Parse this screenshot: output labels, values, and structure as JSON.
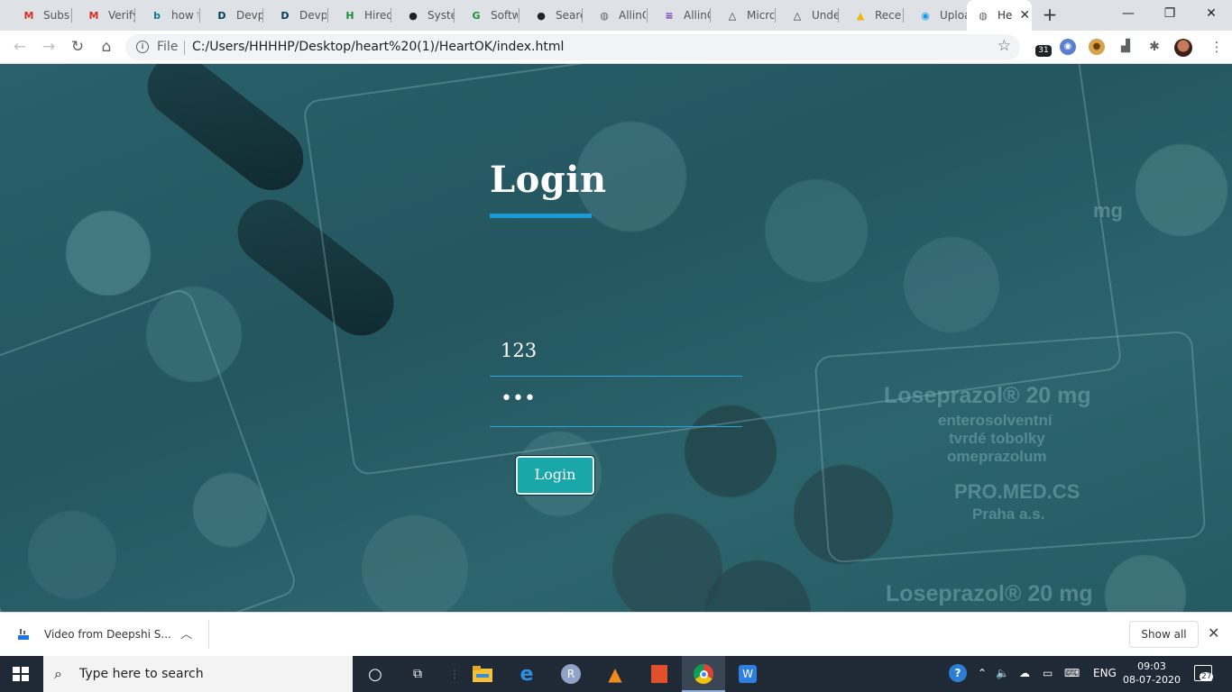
{
  "browser": {
    "tabs": [
      {
        "title": "Subsc",
        "icon": "gmail-icon",
        "glyph": "M",
        "color": "#d93025"
      },
      {
        "title": "Verify",
        "icon": "gmail-icon",
        "glyph": "M",
        "color": "#d93025"
      },
      {
        "title": "how t",
        "icon": "bing-icon",
        "glyph": "b",
        "color": "#0f7c8a"
      },
      {
        "title": "Devpo",
        "icon": "devpost-icon",
        "glyph": "D",
        "color": "#003e54"
      },
      {
        "title": "Devpo",
        "icon": "devpost-icon",
        "glyph": "D",
        "color": "#003e54"
      },
      {
        "title": "Hired",
        "icon": "hired-icon",
        "glyph": "H",
        "color": "#1e8e3e"
      },
      {
        "title": "Syster",
        "icon": "github-icon",
        "glyph": "●",
        "color": "#202124"
      },
      {
        "title": "Softw",
        "icon": "softw-icon",
        "glyph": "G",
        "color": "#1e8e3e"
      },
      {
        "title": "Searcl",
        "icon": "github-icon",
        "glyph": "●",
        "color": "#202124"
      },
      {
        "title": "AllinC",
        "icon": "globe-icon",
        "glyph": "◍",
        "color": "#5f6368"
      },
      {
        "title": "AllinC",
        "icon": "forms-icon",
        "glyph": "≡",
        "color": "#673ab7"
      },
      {
        "title": "Micro",
        "icon": "udemy-icon",
        "glyph": "△",
        "color": "#333"
      },
      {
        "title": "Unde",
        "icon": "udemy-icon",
        "glyph": "△",
        "color": "#333"
      },
      {
        "title": "Recen",
        "icon": "drive-icon",
        "glyph": "▲",
        "color": "#f4b400"
      },
      {
        "title": "Uploa",
        "icon": "upload-icon",
        "glyph": "◉",
        "color": "#1a9be6"
      }
    ],
    "active_tab": {
      "title": "He",
      "icon": "globe-icon"
    },
    "new_tab": "+",
    "window_controls": {
      "minimize": "—",
      "maximize": "❐",
      "close": "✕"
    },
    "url_scheme": "File",
    "url": "C:/Users/HHHHP/Desktop/heart%20(1)/HeartOK/index.html",
    "extensions": [
      {
        "icon": "calendar-icon",
        "label": "31"
      }
    ]
  },
  "page": {
    "title": "Login",
    "username_value": "123",
    "password_value": "•••",
    "login_button": "Login",
    "background_prints": [
      "Loseprazol® 20 mg",
      "enterosolventní",
      "tvrdé tobolky",
      "omeprazolum",
      "PRO.MED.CS",
      "Praha a.s.",
      "Loseprazol® 20 mg",
      "mg"
    ]
  },
  "downloads": {
    "file_name": "Video from Deepshi S...",
    "show_all": "Show all"
  },
  "taskbar": {
    "search_placeholder": "Type here to search",
    "language": "ENG",
    "time": "09:03",
    "date": "08-07-2020",
    "notification_count": "27"
  }
}
